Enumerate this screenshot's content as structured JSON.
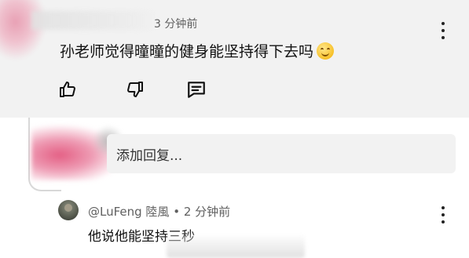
{
  "top_comment": {
    "time": "3 分钟前",
    "text": "孙老师觉得曈曈的健身能坚持得下去吗",
    "emoji": "smiling-face-emoji"
  },
  "actions": {
    "like_icon": "thumbs-up-icon",
    "dislike_icon": "thumbs-down-icon",
    "reply_icon": "comment-icon"
  },
  "reply_input": {
    "placeholder": "添加回复..."
  },
  "reply": {
    "username": "@LuFeng 陸風",
    "separator": "•",
    "time": "2 分钟前",
    "text": "他说他能坚持三秒"
  },
  "colors": {
    "comment_bg": "#f2f2f2",
    "input_bg": "#f2f2f2",
    "meta_text": "#606060"
  }
}
